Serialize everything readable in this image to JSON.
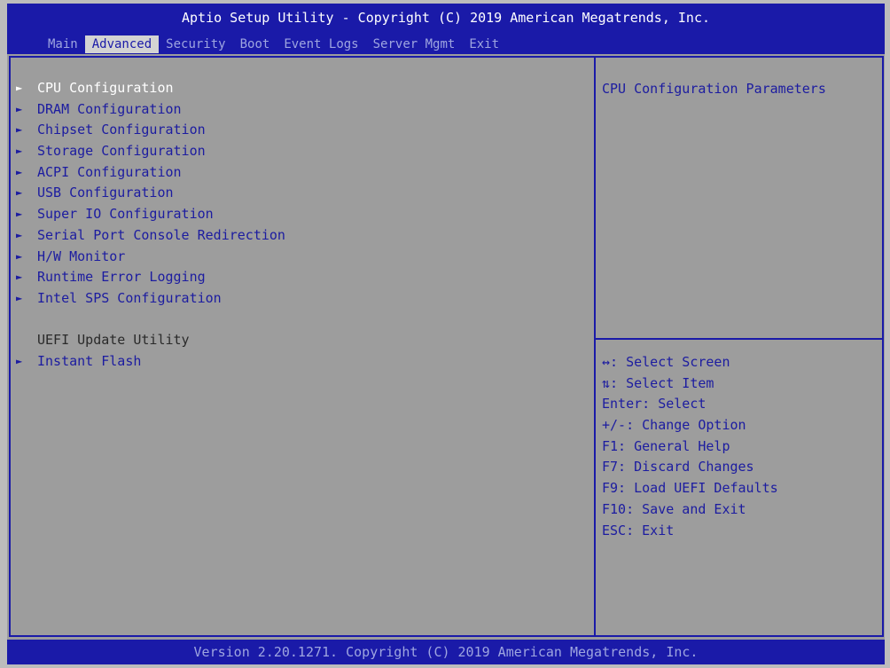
{
  "header": {
    "title": "Aptio Setup Utility - Copyright (C) 2019 American Megatrends, Inc.",
    "tabs": [
      "Main",
      "Advanced",
      "Security",
      "Boot",
      "Event Logs",
      "Server Mgmt",
      "Exit"
    ],
    "active_tab": "Advanced"
  },
  "menu": {
    "items": [
      {
        "label": "CPU Configuration",
        "submenu": true,
        "selected": true
      },
      {
        "label": "DRAM Configuration",
        "submenu": true
      },
      {
        "label": "Chipset Configuration",
        "submenu": true
      },
      {
        "label": "Storage Configuration",
        "submenu": true
      },
      {
        "label": "ACPI Configuration",
        "submenu": true
      },
      {
        "label": "USB Configuration",
        "submenu": true
      },
      {
        "label": "Super IO Configuration",
        "submenu": true
      },
      {
        "label": "Serial Port Console Redirection",
        "submenu": true
      },
      {
        "label": "H/W Monitor",
        "submenu": true
      },
      {
        "label": "Runtime Error Logging",
        "submenu": true
      },
      {
        "label": "Intel SPS Configuration",
        "submenu": true
      }
    ],
    "section_label": "UEFI Update Utility",
    "section_items": [
      {
        "label": "Instant Flash",
        "submenu": true
      }
    ],
    "arrow_glyph": "►"
  },
  "help": {
    "description": "CPU Configuration Parameters",
    "keys": [
      "↔: Select Screen",
      "⇅: Select Item",
      "Enter: Select",
      "+/-: Change Option",
      "F1: General Help",
      "F7: Discard Changes",
      "F9: Load UEFI Defaults",
      "F10: Save and Exit",
      "ESC: Exit"
    ]
  },
  "footer": {
    "text": "Version 2.20.1271. Copyright (C) 2019 American Megatrends, Inc."
  },
  "colors": {
    "blue": "#1a1aa8",
    "panel": "#9d9d9d",
    "text_blue": "#1c1ca0",
    "selected": "#ffffff"
  }
}
